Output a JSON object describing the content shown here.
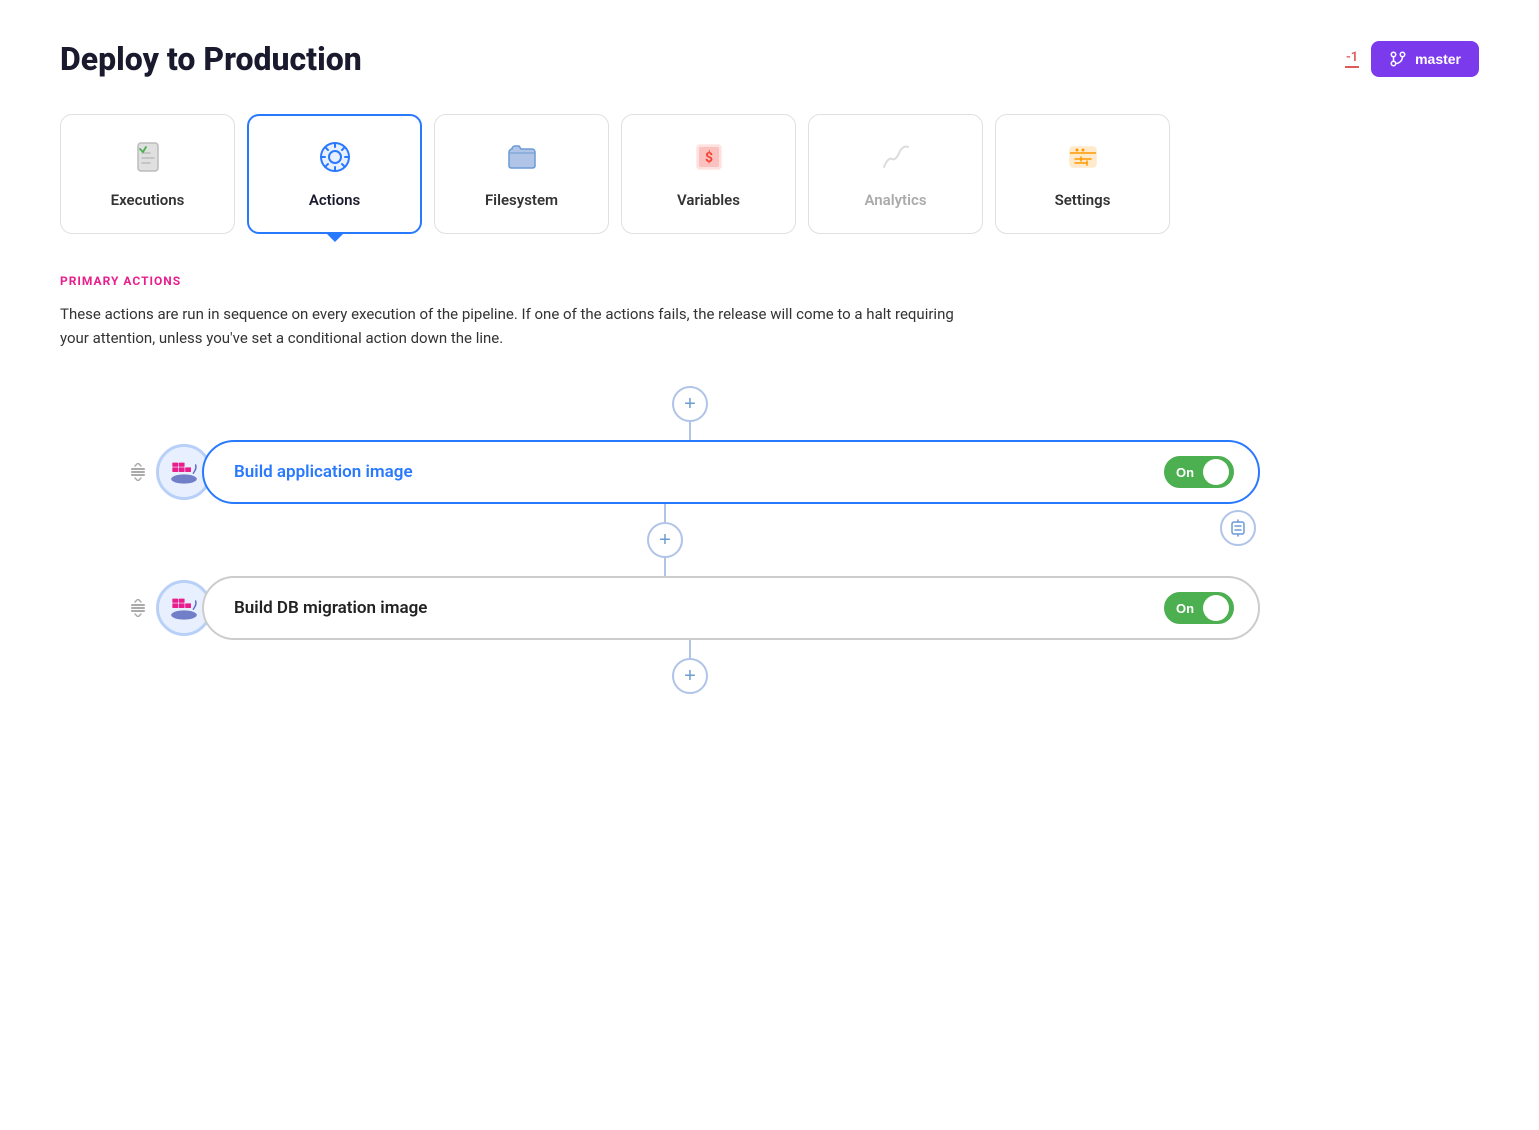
{
  "header": {
    "title": "Deploy to Production",
    "notification": "-1",
    "master_label": "master"
  },
  "tabs": [
    {
      "id": "executions",
      "label": "Executions",
      "icon": "📄",
      "active": false,
      "disabled": false
    },
    {
      "id": "actions",
      "label": "Actions",
      "icon": "⚙️",
      "active": true,
      "disabled": false
    },
    {
      "id": "filesystem",
      "label": "Filesystem",
      "icon": "📁",
      "active": false,
      "disabled": false
    },
    {
      "id": "variables",
      "label": "Variables",
      "icon": "💲",
      "active": false,
      "disabled": false
    },
    {
      "id": "analytics",
      "label": "Analytics",
      "icon": "📈",
      "active": false,
      "disabled": true
    },
    {
      "id": "settings",
      "label": "Settings",
      "icon": "🎛️",
      "active": false,
      "disabled": false
    }
  ],
  "section": {
    "label": "PRIMARY ACTIONS",
    "description": "These actions are run in sequence on every execution of the pipeline. If one of the actions fails, the release will come to a halt requiring your attention, unless you've set a conditional action down the line."
  },
  "actions": [
    {
      "id": "build-app-image",
      "name": "Build application image",
      "toggle": "On",
      "active": true
    },
    {
      "id": "build-db-migration",
      "name": "Build DB migration image",
      "toggle": "On",
      "active": false
    }
  ],
  "add_button_label": "+",
  "drag_icon": "⇅",
  "filter_icon": "⊟"
}
